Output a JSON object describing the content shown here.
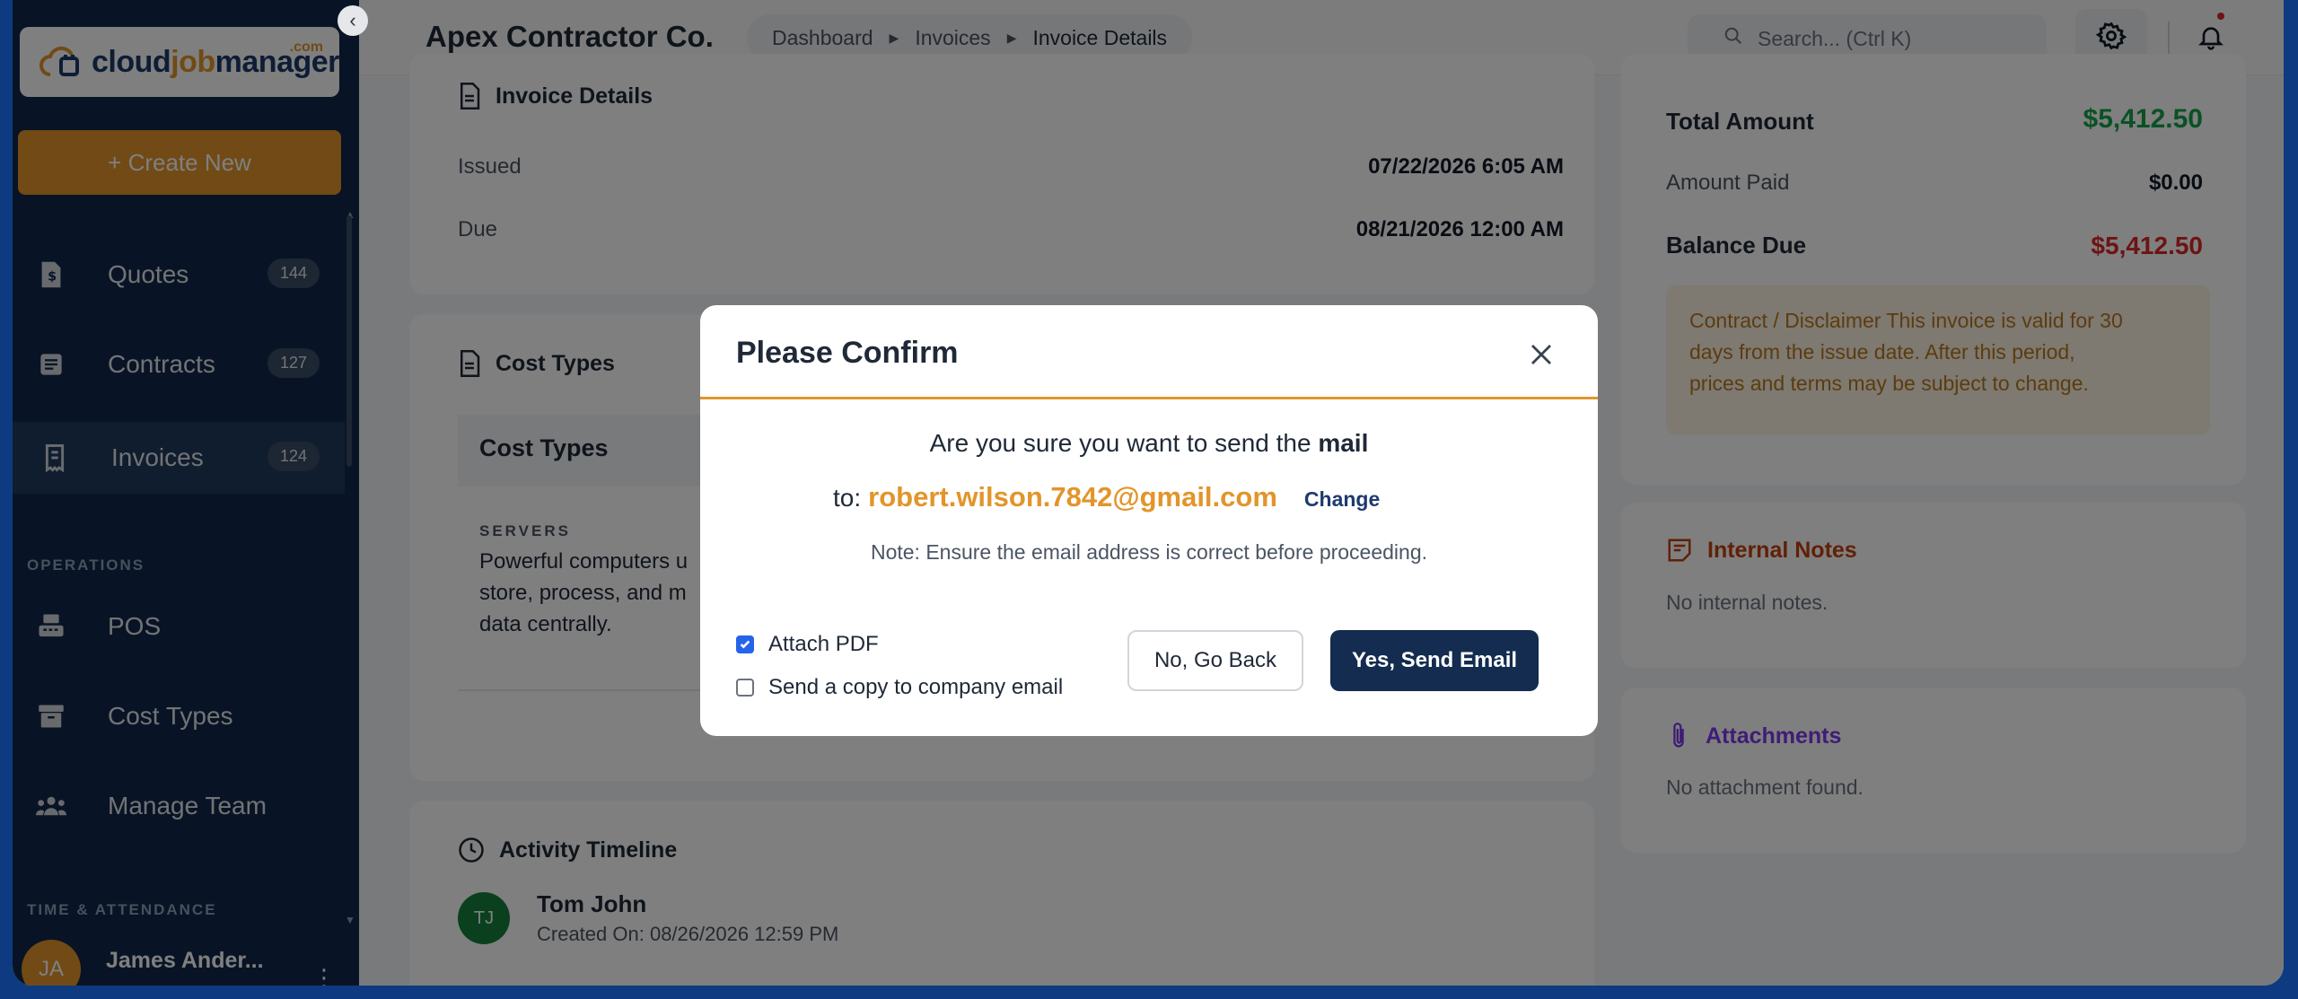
{
  "app": {
    "logo_main": "cloud",
    "logo_accent": "job",
    "logo_tail": "manager",
    "logo_com": ".com",
    "company": "Apex Contractor Co."
  },
  "sidebar": {
    "create_label": "+ Create New",
    "items": [
      {
        "label": "Quotes",
        "badge": "144",
        "icon": "quote-icon"
      },
      {
        "label": "Contracts",
        "badge": "127",
        "icon": "contract-icon"
      },
      {
        "label": "Invoices",
        "badge": "124",
        "icon": "invoice-icon",
        "active": true
      }
    ],
    "section_operations": "OPERATIONS",
    "ops_items": [
      {
        "label": "POS",
        "icon": "pos-icon"
      },
      {
        "label": "Cost Types",
        "icon": "archive-icon"
      },
      {
        "label": "Manage Team",
        "icon": "team-icon"
      }
    ],
    "section_time": "TIME & ATTENDANCE",
    "user": {
      "initials": "JA",
      "name": "James Ander..."
    }
  },
  "header": {
    "breadcrumb": [
      "Dashboard",
      "Invoices",
      "Invoice Details"
    ],
    "search_placeholder": "Search... (Ctrl K)"
  },
  "invoice_details": {
    "title": "Invoice Details",
    "issued_label": "Issued",
    "issued_value": "07/22/2026 6:05 AM",
    "due_label": "Due",
    "due_value": "08/21/2026 12:00 AM"
  },
  "cost_types": {
    "title": "Cost Types",
    "table_header": "Cost Types",
    "item_category": "SERVERS",
    "item_desc_l1": "Powerful computers u",
    "item_desc_l2": "store, process, and m",
    "item_desc_l3": "data centrally."
  },
  "activity": {
    "title": "Activity Timeline",
    "initials": "TJ",
    "name": "Tom John",
    "created": "Created On: 08/26/2026 12:59 PM"
  },
  "totals": {
    "total_label": "Total Amount",
    "total_value": "$5,412.50",
    "paid_label": "Amount Paid",
    "paid_value": "$0.00",
    "balance_label": "Balance Due",
    "balance_value": "$5,412.50",
    "disclaimer_l1": "Contract / Disclaimer This invoice is valid for 30",
    "disclaimer_l2": "days from the issue date. After this period,",
    "disclaimer_l3": "prices and terms may be subject to change."
  },
  "notes": {
    "title": "Internal Notes",
    "empty": "No internal notes."
  },
  "attachments": {
    "title": "Attachments",
    "empty": "No attachment found."
  },
  "modal": {
    "title": "Please Confirm",
    "confirm_text": "Are you sure you want to send the",
    "confirm_bold": "mail",
    "to_label": "to:",
    "email": "robert.wilson.7842@gmail.com",
    "change_label": "Change",
    "note": "Note: Ensure the email address is correct before proceeding.",
    "attach_pdf_label": "Attach PDF",
    "attach_pdf_checked": true,
    "copy_label": "Send a copy to company email",
    "copy_checked": false,
    "back_label": "No, Go Back",
    "send_label": "Yes, Send Email"
  },
  "colors": {
    "accent": "#e2952a",
    "navy": "#132c4f",
    "total_green": "#16a34a",
    "balance_red": "#dc2626",
    "notes_red": "#c2410c",
    "attach_purple": "#7c3aed"
  }
}
